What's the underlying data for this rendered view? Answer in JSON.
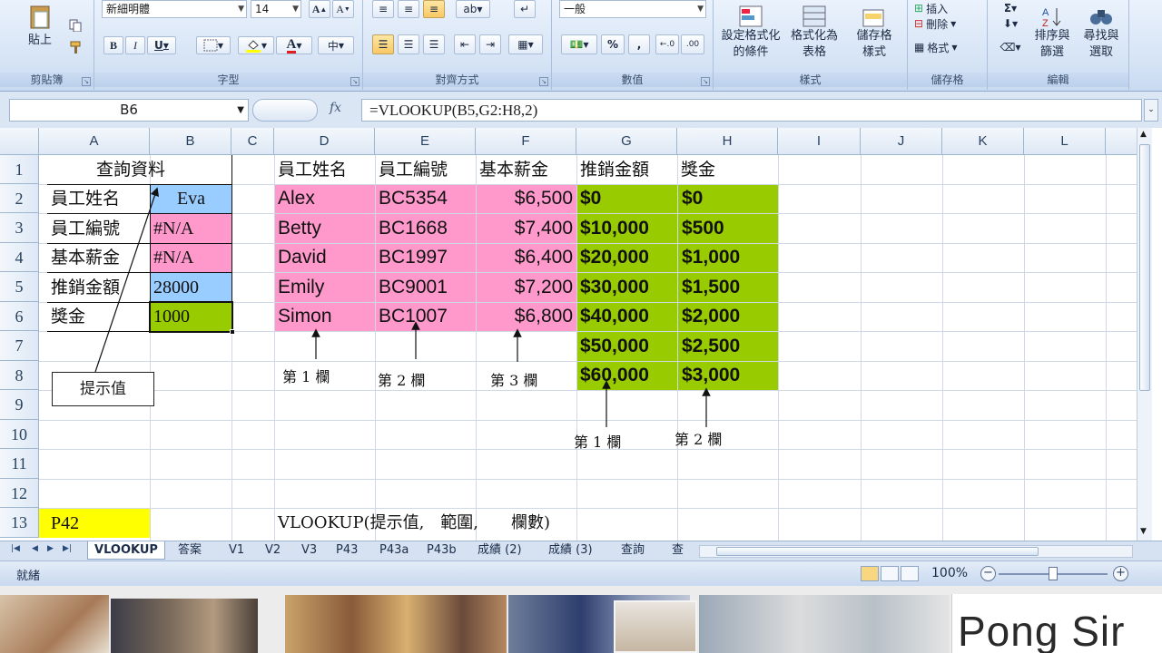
{
  "ribbon": {
    "font": {
      "face": "新細明體",
      "size": "14",
      "label": "字型"
    },
    "clipboard": {
      "paste": "貼上",
      "label": "剪貼簿"
    },
    "alignment": {
      "label": "對齊方式"
    },
    "number": {
      "format": "一般",
      "label": "數值"
    },
    "styles": {
      "conditional": "設定格式化",
      "conditional2": "的條件",
      "table": "格式化為",
      "table2": "表格",
      "cell": "儲存格",
      "cell2": "樣式",
      "label": "樣式"
    },
    "cells": {
      "insert": "插入",
      "delete": "刪除",
      "format": "格式",
      "label": "儲存格"
    },
    "editing": {
      "sort": "排序與",
      "sort2": "篩選",
      "find": "尋找與",
      "find2": "選取",
      "label": "編輯"
    }
  },
  "formula_bar": {
    "name_box": "B6",
    "formula": "=VLOOKUP(B5,G2:H8,2)"
  },
  "columns": [
    "A",
    "B",
    "C",
    "D",
    "E",
    "F",
    "G",
    "H",
    "I",
    "J",
    "K",
    "L"
  ],
  "rows": [
    "1",
    "2",
    "3",
    "4",
    "5",
    "6",
    "7",
    "8",
    "9",
    "10",
    "11",
    "12",
    "13"
  ],
  "lookup": {
    "title": "查詢資料",
    "labels": [
      "員工姓名",
      "員工編號",
      "基本薪金",
      "推銷金額",
      "獎金"
    ],
    "values": [
      "Eva",
      "#N/A",
      "#N/A",
      "28000",
      "1000"
    ]
  },
  "table": {
    "headers": [
      "員工姓名",
      "員工編號",
      "基本薪金",
      "推銷金額",
      "獎金"
    ],
    "employees": [
      {
        "name": "Alex",
        "id": "BC5354",
        "salary": "$6,500"
      },
      {
        "name": "Betty",
        "id": "BC1668",
        "salary": "$7,400"
      },
      {
        "name": "David",
        "id": "BC1997",
        "salary": "$6,400"
      },
      {
        "name": "Emily",
        "id": "BC9001",
        "salary": "$7,200"
      },
      {
        "name": "Simon",
        "id": "BC1007",
        "salary": "$6,800"
      }
    ],
    "bonus_table": [
      {
        "sales": "$0",
        "bonus": "$0"
      },
      {
        "sales": "$10,000",
        "bonus": "$500"
      },
      {
        "sales": "$20,000",
        "bonus": "$1,000"
      },
      {
        "sales": "$30,000",
        "bonus": "$1,500"
      },
      {
        "sales": "$40,000",
        "bonus": "$2,000"
      },
      {
        "sales": "$50,000",
        "bonus": "$2,500"
      },
      {
        "sales": "$60,000",
        "bonus": "$3,000"
      }
    ]
  },
  "annotations": {
    "hint": "提示值",
    "col1": "第 1 欄",
    "col2": "第 2 欄",
    "col3": "第 3 欄",
    "bcol1": "第 1 欄",
    "bcol2": "第 2 欄",
    "p42": "P42",
    "syntax": "VLOOKUP(提示值,　範圍,　　欄數)"
  },
  "sheet_tabs": [
    "VLOOKUP",
    "答案",
    "V1",
    "V2",
    "V3",
    "P43",
    "P43a",
    "P43b",
    "成績 (2)",
    "成績 (3)",
    "查詢",
    "查"
  ],
  "status": {
    "ready": "就緒",
    "zoom": "100%"
  },
  "banner": {
    "brand": "Pong Sir"
  },
  "colors": {
    "pink": "#ff99cc",
    "blue": "#99ccff",
    "green": "#99cc00",
    "yellow": "#ffff00",
    "active_tab": "#ffffff"
  }
}
